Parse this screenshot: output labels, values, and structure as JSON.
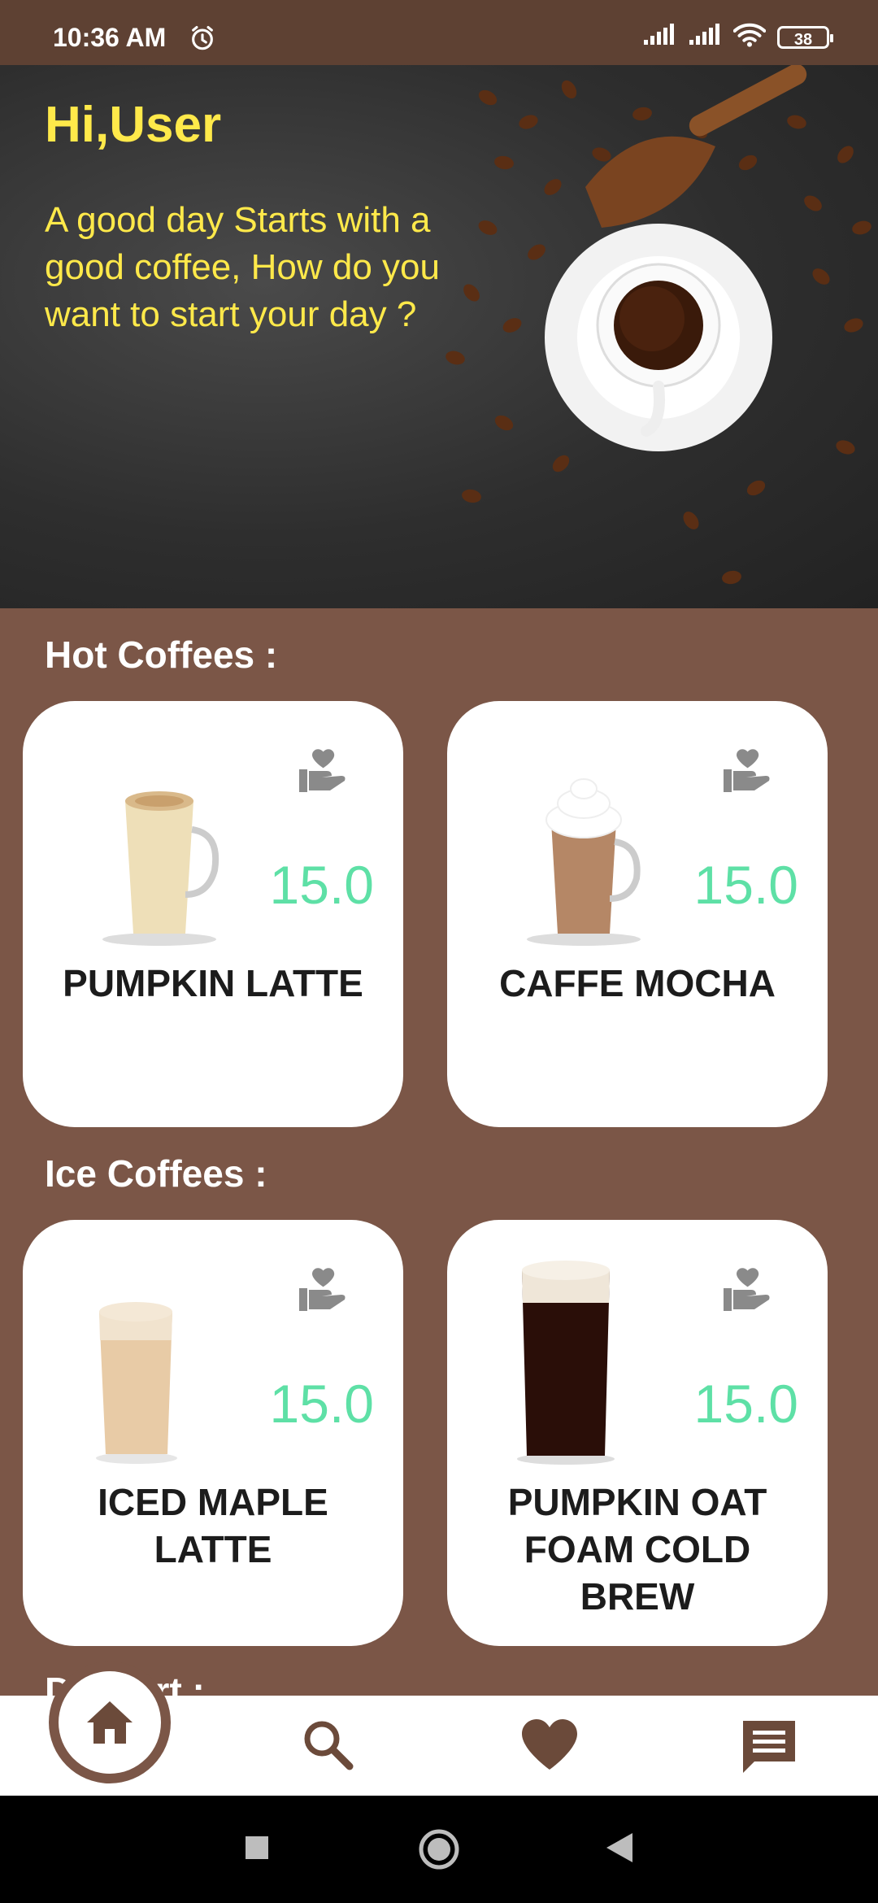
{
  "status_bar": {
    "time": "10:36 AM",
    "battery": "38"
  },
  "hero": {
    "greeting": "Hi,User",
    "tagline": "A good day Starts with a\n good coffee, How do you\n want to start your day ?"
  },
  "sections": {
    "hot": {
      "title": "Hot Coffees :",
      "items": [
        {
          "name": "PUMPKIN LATTE",
          "price": "15.0"
        },
        {
          "name": "CAFFE MOCHA",
          "price": "15.0"
        }
      ]
    },
    "ice": {
      "title": "Ice Coffees :",
      "items": [
        {
          "name": "ICED MAPLE LATTE",
          "price": "15.0"
        },
        {
          "name": "PUMPKIN OAT FOAM COLD BREW",
          "price": "15.0"
        }
      ]
    },
    "dessert": {
      "title": "Dessert :"
    }
  },
  "nav": {
    "icons": [
      "home-icon",
      "search-icon",
      "heart-icon",
      "chat-icon"
    ]
  },
  "colors": {
    "background": "#7B5647",
    "status_bar": "#5E4133",
    "accent_yellow": "#FFE94A",
    "price_green": "#5EE0A6",
    "brown_icon": "#6B4A3A"
  }
}
